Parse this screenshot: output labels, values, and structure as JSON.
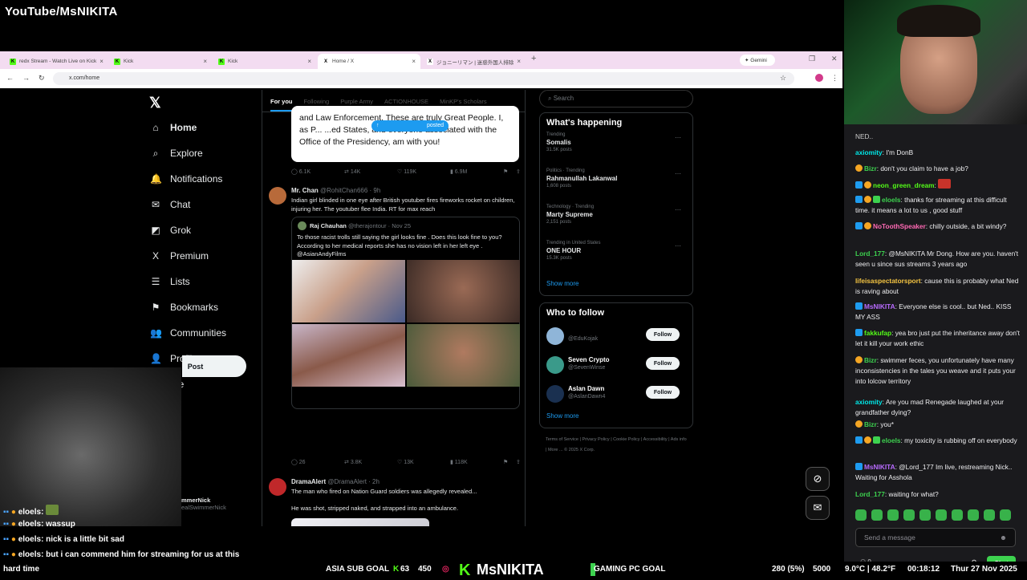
{
  "overlay": {
    "brand": "YouTube/MsNIKITA",
    "goal_left_label": "ASIA SUB GOAL",
    "goal_left_current": "63",
    "goal_left_target": "450",
    "logo_text": "MsNIKITA",
    "goal_right_label": "GAMING PC GOAL",
    "goal_right_progress": "280 (5%)",
    "goal_right_target": "5000",
    "weather": "9.0°C | 48.2°F",
    "timer": "00:18:12",
    "date": "Thur 27 Nov 2025",
    "chat_overlay": [
      {
        "user": "eloels",
        "text": ""
      },
      {
        "user": "eloels",
        "text": "wassup"
      },
      {
        "user": "eloels",
        "text": "nick is a little bit sad"
      },
      {
        "user": "eloels",
        "text": "but i can commend him for streaming for us at this"
      }
    ],
    "chat_overlay_tail": "hard time"
  },
  "browser": {
    "tabs": [
      {
        "label": "redx Stream - Watch Live on Kick",
        "fav": "K",
        "color": "#53fc18"
      },
      {
        "label": "Kick",
        "fav": "K",
        "color": "#53fc18"
      },
      {
        "label": "Kick",
        "fav": "K",
        "color": "#53fc18"
      },
      {
        "label": "Home / X",
        "fav": "X",
        "color": "#ffffff"
      },
      {
        "label": "ジョニーリマン | 迷惑外国人排除",
        "fav": "X",
        "color": "#ffffff"
      }
    ],
    "gemini_label": "Gemini",
    "url": "x.com/home"
  },
  "x": {
    "nav": [
      {
        "label": "Home",
        "icon": "home-icon",
        "glyph": "⌂"
      },
      {
        "label": "Explore",
        "icon": "search-icon",
        "glyph": "⌕"
      },
      {
        "label": "Notifications",
        "icon": "bell-icon",
        "glyph": "🔔"
      },
      {
        "label": "Chat",
        "icon": "mail-icon",
        "glyph": "✉"
      },
      {
        "label": "Grok",
        "icon": "grok-icon",
        "glyph": "◩"
      },
      {
        "label": "Premium",
        "icon": "x-icon",
        "glyph": "X"
      },
      {
        "label": "Lists",
        "icon": "list-icon",
        "glyph": "☰"
      },
      {
        "label": "Bookmarks",
        "icon": "bookmark-icon",
        "glyph": "⚑"
      },
      {
        "label": "Communities",
        "icon": "people-icon",
        "glyph": "👥"
      },
      {
        "label": "Profile",
        "icon": "person-icon",
        "glyph": "👤"
      },
      {
        "label": "ore",
        "icon": "more-icon",
        "glyph": ""
      }
    ],
    "post_label": "Post",
    "account_name": "mmerNick",
    "account_handle": "ealSwimmerNick",
    "feed_tabs": [
      "For you",
      "Following",
      "Purple Army",
      "ACTIONHOUSE",
      "MinKP's Scholars"
    ],
    "quote_card": {
      "text": "and Law Enforcement. These are truly Great People. I, as P... ...ed States, and everyone associated with the Office of the Presidency, am with you!",
      "posted_pill": "posted"
    },
    "actions1": [
      "6.1K",
      "14K",
      "119K",
      "6.9M"
    ],
    "tweet2": {
      "name": "Mr. Chan",
      "handle": "@RohitChan666 · 9h",
      "text": "Indian girl blinded in one eye after British youtuber fires fireworks rocket on children, injuring her. The youtuber flee India. RT for max reach",
      "quote_name": "Raj Chauhan",
      "quote_handle": "@therajontour · Nov 25",
      "quote_text": "To those racist trolls still saying the girl looks fine . Does this look fine to you? According to her medical reports she has no vision left in her left eye . @AsianAndyFilms"
    },
    "actions2": [
      "26",
      "3.8K",
      "13K",
      "118K"
    ],
    "tweet3": {
      "name": "DramaAlert",
      "handle": "@DramaAlert · 2h",
      "text1": "The man who fired on Nation Guard soldiers was allegedly revealed...",
      "text2": "He was shot, stripped naked, and strapped into an ambulance."
    },
    "search_placeholder": "Search",
    "happening_title": "What's happening",
    "trends": [
      {
        "cat": "Trending",
        "title": "Somalis",
        "count": "31.5K posts"
      },
      {
        "cat": "Politics · Trending",
        "title": "Rahmanullah Lakanwal",
        "count": "1,608 posts"
      },
      {
        "cat": "Technology · Trending",
        "title": "Marty Supreme",
        "count": "2,151 posts"
      },
      {
        "cat": "Trending in United States",
        "title": "ONE HOUR",
        "count": "15.3K posts"
      }
    ],
    "show_more": "Show more",
    "who_title": "Who to follow",
    "who": [
      {
        "name": "",
        "handle": "@EduKojak",
        "follow": "Follow",
        "color": "#8fb5d8"
      },
      {
        "name": "Seven Crypto",
        "handle": "@SevenWinse",
        "follow": "Follow",
        "color": "#3a9a8a"
      },
      {
        "name": "Aslan Dawn",
        "handle": "@AslanDawn4",
        "follow": "Follow",
        "color": "#1a3050"
      }
    ],
    "footer": "Terms of Service | Privacy Policy | Cookie Policy | Accessibility | Ads info | More ... © 2025 X Corp."
  },
  "chat": {
    "first_line": "NED..",
    "messages": [
      {
        "user": "axiomity",
        "color": "#00e6e6",
        "text": "I'm DonB",
        "badges": []
      },
      {
        "user": "Bizr",
        "color": "#3dd24f",
        "text": "don't you claim to have a job?",
        "badges": [
          "gold"
        ]
      },
      {
        "user": "neon_green_dream",
        "color": "#53fc18",
        "text": "",
        "badges": [
          "blue",
          "gold"
        ]
      },
      {
        "user": "eloels",
        "color": "#3dd24f",
        "text": "thanks for streaming at this difficult time. it means a lot to us , good stuff",
        "badges": [
          "blue",
          "gold",
          "green"
        ]
      },
      {
        "user": "NoToothSpeaker",
        "color": "#ff69b4",
        "text": "chilly outside, a bit windy?",
        "badges": [
          "blue",
          "gold"
        ]
      },
      {
        "user": "Lord_177",
        "color": "#3dd24f",
        "text": "@MsNIKITA Mr Dong. How are you. haven't seen u since sus streams 3 years ago",
        "badges": []
      },
      {
        "user": "lifeisaspectatorsport",
        "color": "#f5c542",
        "text": "cause this is probably what Ned is raving about",
        "badges": []
      },
      {
        "user": "MsNIKITA",
        "color": "#b86bff",
        "text": "Everyone else is cool.. but Ned.. KISS MY ASS",
        "badges": [
          "blue"
        ]
      },
      {
        "user": "fakkufap",
        "color": "#53fc18",
        "text": "yea bro just put the inheritance away don't let it kill your work ethic",
        "badges": [
          "blue"
        ]
      },
      {
        "user": "Bizr",
        "color": "#3dd24f",
        "text": "swimmer feces, you unfortunately have many inconsistencies in the tales you weave and it puts your into lolcow territory",
        "badges": [
          "gold"
        ]
      },
      {
        "user": "axiomity",
        "color": "#00e6e6",
        "text": "Are you mad Renegade laughed at your grandfather dying?",
        "badges": []
      },
      {
        "user": "Bizr",
        "color": "#3dd24f",
        "text": "you*",
        "badges": [
          "gold"
        ]
      },
      {
        "user": "eloels",
        "color": "#3dd24f",
        "text": "my toxicity is rubbing off on everybody",
        "badges": [
          "blue",
          "gold",
          "green"
        ]
      },
      {
        "user": "MsNIKITA",
        "color": "#b86bff",
        "text": "@Lord_177 Im live, restreaming Nick.. Waiting for Asshola",
        "badges": [
          "blue"
        ]
      },
      {
        "user": "Lord_177",
        "color": "#3dd24f",
        "text": "waiting for what?",
        "badges": []
      }
    ],
    "input_placeholder": "Send a message",
    "chat_button": "Chat",
    "viewer_count": "0"
  }
}
